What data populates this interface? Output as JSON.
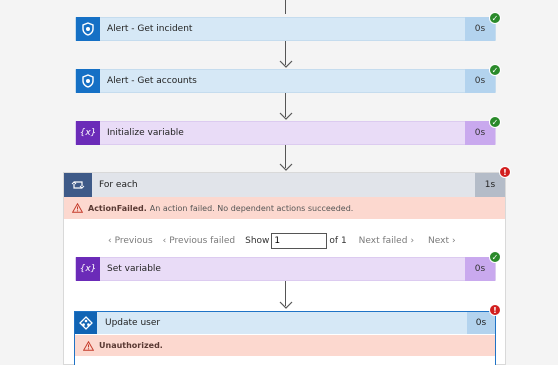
{
  "colors": {
    "sentinel_blue": "#1570c5",
    "variable_purple": "#6b2bb8",
    "foreach_navy": "#3e5a88",
    "success_green": "#2a8a2a",
    "error_red": "#d21f1f",
    "error_bg": "#fcd8cf"
  },
  "steps": [
    {
      "name": "Alert - Get incident",
      "duration": "0s",
      "status": "success",
      "icon": "sentinel-shield-icon"
    },
    {
      "name": "Alert - Get accounts",
      "duration": "0s",
      "status": "success",
      "icon": "sentinel-shield-icon"
    },
    {
      "name": "Initialize variable",
      "duration": "0s",
      "status": "success",
      "icon": "variable-icon"
    }
  ],
  "foreach": {
    "name": "For each",
    "duration": "1s",
    "status": "error",
    "icon": "loop-icon",
    "error_title": "ActionFailed.",
    "error_message": "An action failed. No dependent actions succeeded.",
    "pager": {
      "previous": "Previous",
      "previous_failed": "Previous failed",
      "show_label": "Show",
      "current_value": "1",
      "of_label": "of 1",
      "next_failed": "Next failed",
      "next": "Next"
    },
    "set_variable": {
      "name": "Set variable",
      "duration": "0s",
      "status": "success",
      "icon": "variable-icon"
    },
    "update_user": {
      "name": "Update user",
      "duration": "0s",
      "status": "error",
      "icon": "azure-ad-icon",
      "error_title": "Unauthorized."
    }
  },
  "glyphs": {
    "variable": "{x}",
    "ok": "✓",
    "err": "!"
  }
}
